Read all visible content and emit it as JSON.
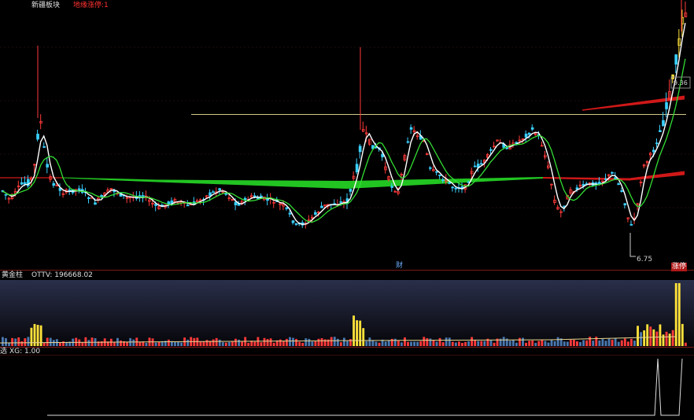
{
  "header": {
    "left_label": "新疆板块",
    "right_label": "地缘涨停:1"
  },
  "main_panel": {
    "low_value": "6.75",
    "right_price": "9.36",
    "marker_text": "财",
    "corner_tag": "涨停"
  },
  "volume_panel": {
    "indicator_name": "黄金柱",
    "readout": "OTTV: 196668.02"
  },
  "signal_panel": {
    "readout": "XG: 1.00",
    "prefix": "选"
  },
  "colors": {
    "up": "#ff3a3a",
    "down": "#3ad0ff",
    "ma_white": "#ffffff",
    "ma_green": "#33dd33",
    "ribbon_green": "#22c422",
    "ribbon_red": "#d01818",
    "hline": "#d2c98a",
    "gold": "#ffe23a",
    "panel_border": "#7a1a1a"
  },
  "chart_data": {
    "type": "candlestick",
    "series": [
      {
        "name": "price",
        "pattern": "flat-rally-consolidate-dip-breakout",
        "count": 215
      },
      {
        "name": "volume",
        "note": "gold bars mark volume surges"
      },
      {
        "name": "XG",
        "values_at_end": [
          1,
          0,
          1
        ]
      }
    ],
    "annotations": [
      "6.75",
      "9.36"
    ]
  }
}
